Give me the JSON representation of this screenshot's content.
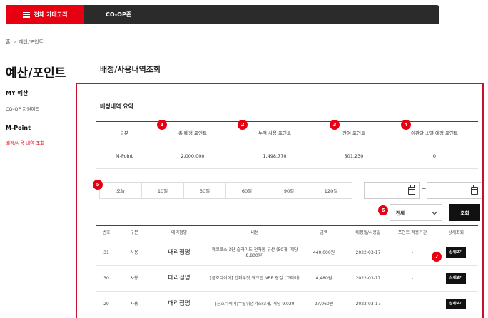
{
  "nav": {
    "category_label": "전체 카테고리",
    "coop_label": "CO-OP존"
  },
  "breadcrumb": {
    "home": "홈",
    "separator": ">",
    "current": "예산/포인트"
  },
  "sidebar": {
    "title": "예산/포인트",
    "sections": [
      {
        "title": "MY 예산",
        "items": [
          {
            "label": "CO-OP 지원이력",
            "active": false
          }
        ]
      },
      {
        "title": "M-Point",
        "items": [
          {
            "label": "배정/사용 내역 조회",
            "active": true
          }
        ]
      }
    ]
  },
  "main": {
    "title": "배정/사용내역조회",
    "summary": {
      "title": "배정내역 요약",
      "headers": [
        "구분",
        "총 배정 포인트",
        "누적 사용 포인트",
        "잔여 포인트",
        "이관달 소멸 예정 포인트"
      ],
      "row": [
        "M-Point",
        "2,000,000",
        "1,498,770",
        "501,230",
        "0"
      ]
    },
    "periods": [
      "오늘",
      "10일",
      "30일",
      "60일",
      "90일",
      "120일"
    ],
    "date_separator": "~",
    "filter": {
      "selected": "전체"
    },
    "search_label": "조회",
    "badges": [
      "1",
      "2",
      "3",
      "4",
      "5",
      "6",
      "7"
    ],
    "table": {
      "headers": [
        "번호",
        "구분",
        "대리점명",
        "내용",
        "금액",
        "배정일/사용일",
        "포인트 적용기간",
        "상세조회"
      ],
      "rows": [
        {
          "no": "31",
          "type": "사용",
          "agency": "대리점명",
          "content": "휴코로스 3단 슬라이드 전자동 우산 (50개, 개당 8,800원)",
          "amount": "440,000원",
          "date": "2022-03-17",
          "period": "-",
          "detail": "상세보기"
        },
        {
          "no": "30",
          "type": "사용",
          "agency": "대리점명",
          "content": "[금호타이어] 컨퍼우젓 워크런 NBR 장갑 (그레이)",
          "amount": "4,480원",
          "date": "2022-03-17",
          "period": "-",
          "detail": "상세보기"
        },
        {
          "no": "29",
          "type": "사용",
          "agency": "대리점명",
          "content": "[금호타이어]무릴위엄서조(3개, 개당 9,020",
          "amount": "27,060원",
          "date": "2022-03-17",
          "period": "-",
          "detail": "상세보기"
        }
      ]
    }
  },
  "colors": {
    "accent": "#e60012",
    "panel_border": "#c8102e",
    "nav_bg": "#2b2b2b",
    "button_dark": "#111111"
  }
}
